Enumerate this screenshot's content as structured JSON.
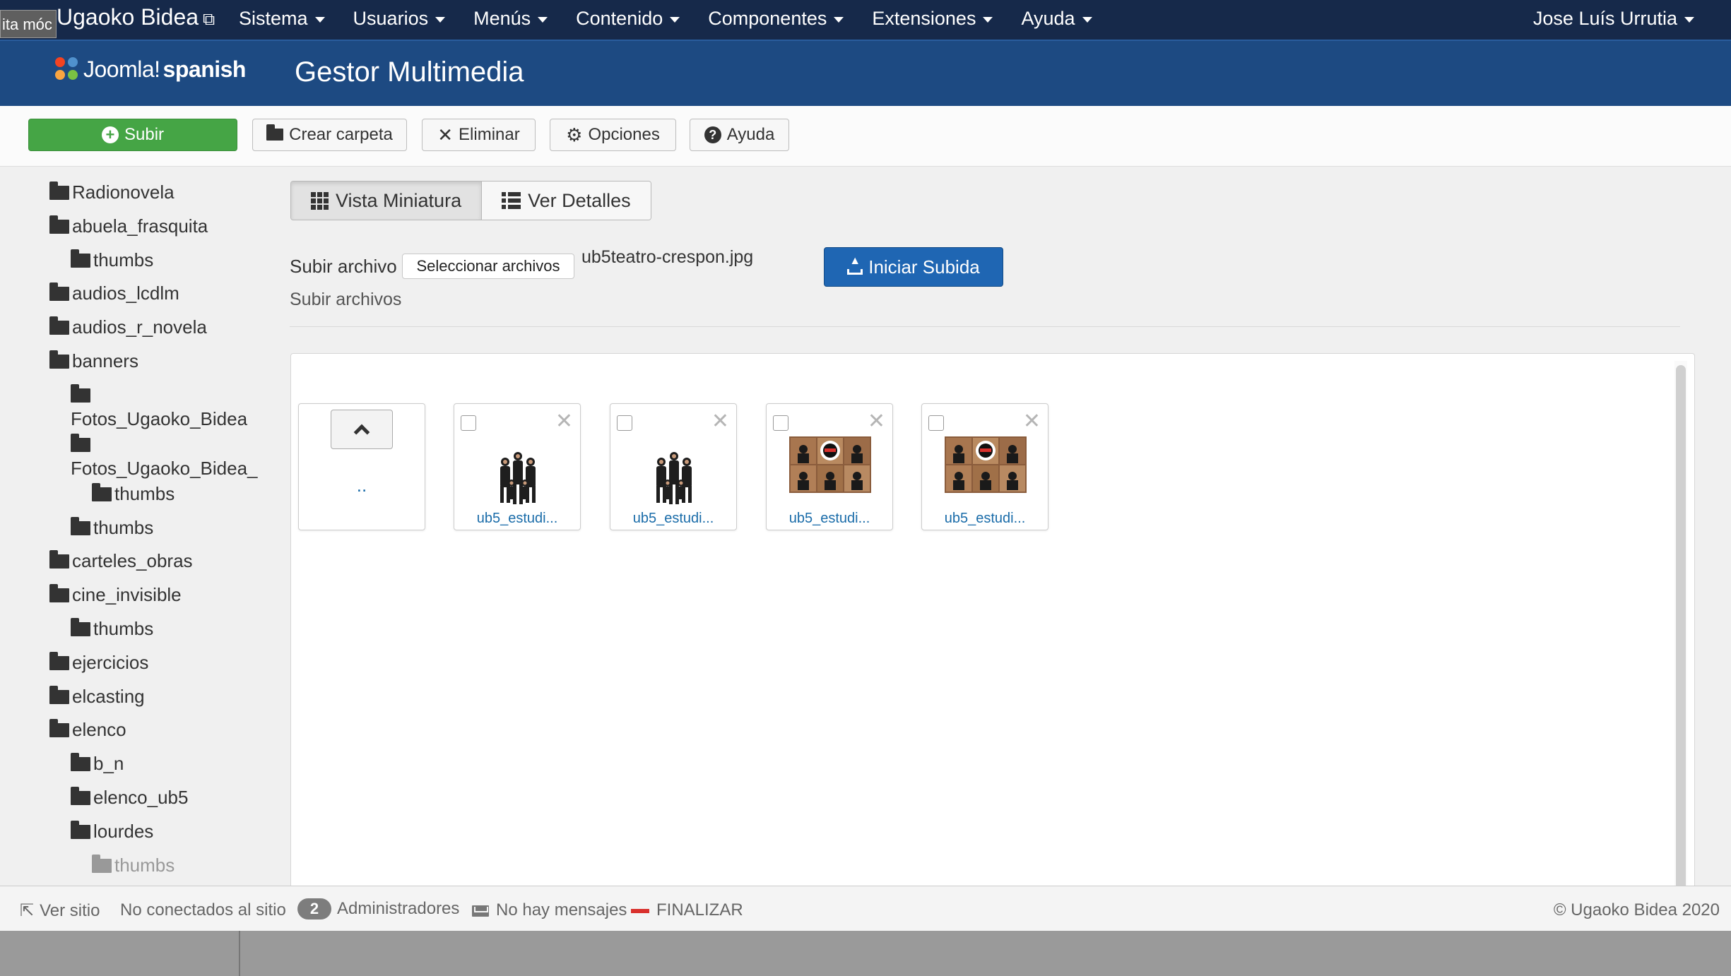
{
  "navbar": {
    "tooltip": "ita móc",
    "site_name": "Ugaoko Bidea",
    "site_link_icon": "external-link-icon",
    "menu": [
      "Sistema",
      "Usuarios",
      "Menús",
      "Contenido",
      "Componentes",
      "Extensiones",
      "Ayuda"
    ],
    "user": "Jose Luís Urrutia"
  },
  "header": {
    "logo_text": "Joomla!",
    "logo_suffix": "spanish",
    "title": "Gestor Multimedia"
  },
  "toolbar": {
    "upload": "Subir",
    "create_folder": "Crear carpeta",
    "delete": "Eliminar",
    "options": "Opciones",
    "help": "Ayuda"
  },
  "tree": [
    {
      "name": "Radionovela",
      "level": 0
    },
    {
      "name": "abuela_frasquita",
      "level": 0
    },
    {
      "name": "thumbs",
      "level": 1
    },
    {
      "name": "audios_lcdlm",
      "level": 0
    },
    {
      "name": "audios_r_novela",
      "level": 0
    },
    {
      "name": "banners",
      "level": 0
    },
    {
      "name": "Fotos_Ugaoko_Bidea",
      "level": 1
    },
    {
      "name": "Fotos_Ugaoko_Bidea_",
      "level": 1
    },
    {
      "name": "thumbs",
      "level": 2
    },
    {
      "name": "thumbs",
      "level": 1
    },
    {
      "name": "carteles_obras",
      "level": 0
    },
    {
      "name": "cine_invisible",
      "level": 0
    },
    {
      "name": "thumbs",
      "level": 1
    },
    {
      "name": "ejercicios",
      "level": 0
    },
    {
      "name": "elcasting",
      "level": 0
    },
    {
      "name": "elenco",
      "level": 0
    },
    {
      "name": "b_n",
      "level": 1
    },
    {
      "name": "elenco_ub5",
      "level": 1
    },
    {
      "name": "lourdes",
      "level": 1
    },
    {
      "name": "thumbs",
      "level": 2
    }
  ],
  "views": {
    "thumbnail": "Vista Miniatura",
    "details": "Ver Detalles"
  },
  "upload": {
    "label": "Subir archivo",
    "select_button": "Seleccionar archivos",
    "selected_file": "ub5teatro-crespon.jpg",
    "start_button": "Iniciar Subida",
    "files_link": "Subir archivos"
  },
  "media": {
    "up_label": "..",
    "items": [
      {
        "name": "ub5_estudi...",
        "kind": "group"
      },
      {
        "name": "ub5_estudi...",
        "kind": "group"
      },
      {
        "name": "ub5_estudi...",
        "kind": "collage"
      },
      {
        "name": "ub5_estudi...",
        "kind": "collage"
      }
    ]
  },
  "footer": {
    "view_site": "Ver sitio",
    "not_connected": "No conectados al sitio",
    "admins_count": "2",
    "admins_label": "Administradores",
    "messages": "No hay mensajes",
    "logout": "FINALIZAR",
    "copyright": "© Ugaoko Bidea 2020"
  },
  "colors": {
    "navbar": "#16294a",
    "header": "#1d4a82",
    "upload_green": "#45a545",
    "start_blue": "#1f66b3",
    "link_blue": "#1a6ca9"
  }
}
